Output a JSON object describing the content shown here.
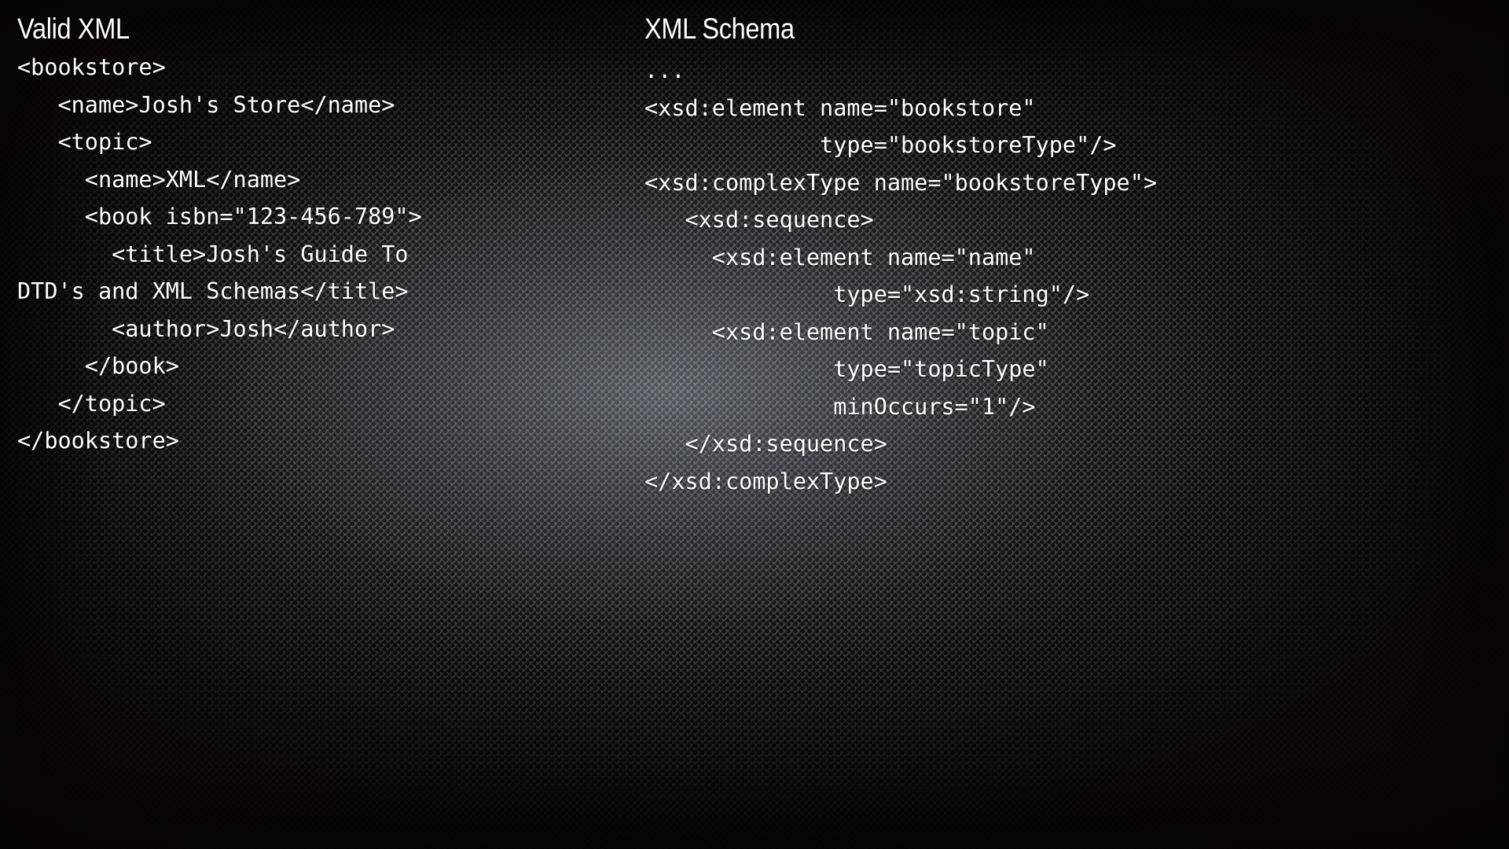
{
  "slide": {
    "background_base_color": "#2b2d2f",
    "background_texture": "perforated-metal-mesh",
    "vignette_color": "#0c0505",
    "text_color": "#ffffff"
  },
  "columns": [
    {
      "id": "valid-xml",
      "title": "Valid XML",
      "lines": [
        "<bookstore>",
        "   <name>Josh's Store</name>",
        "   <topic>",
        "     <name>XML</name>",
        "     <book isbn=\"123-456-789\">",
        "       <title>Josh's Guide To",
        "DTD's and XML Schemas</title>",
        "       <author>Josh</author>",
        "     </book>",
        "   </topic>",
        "</bookstore>"
      ]
    },
    {
      "id": "xml-schema",
      "title": "XML Schema",
      "lines": [
        "...",
        "<xsd:element name=\"bookstore\"",
        "             type=\"bookstoreType\"/>",
        "<xsd:complexType name=\"bookstoreType\">",
        "   <xsd:sequence>",
        "     <xsd:element name=\"name\"",
        "              type=\"xsd:string\"/>",
        "     <xsd:element name=\"topic\"",
        "              type=\"topicType\"",
        "              minOccurs=\"1\"/>",
        "   </xsd:sequence>",
        "</xsd:complexType>"
      ]
    }
  ]
}
